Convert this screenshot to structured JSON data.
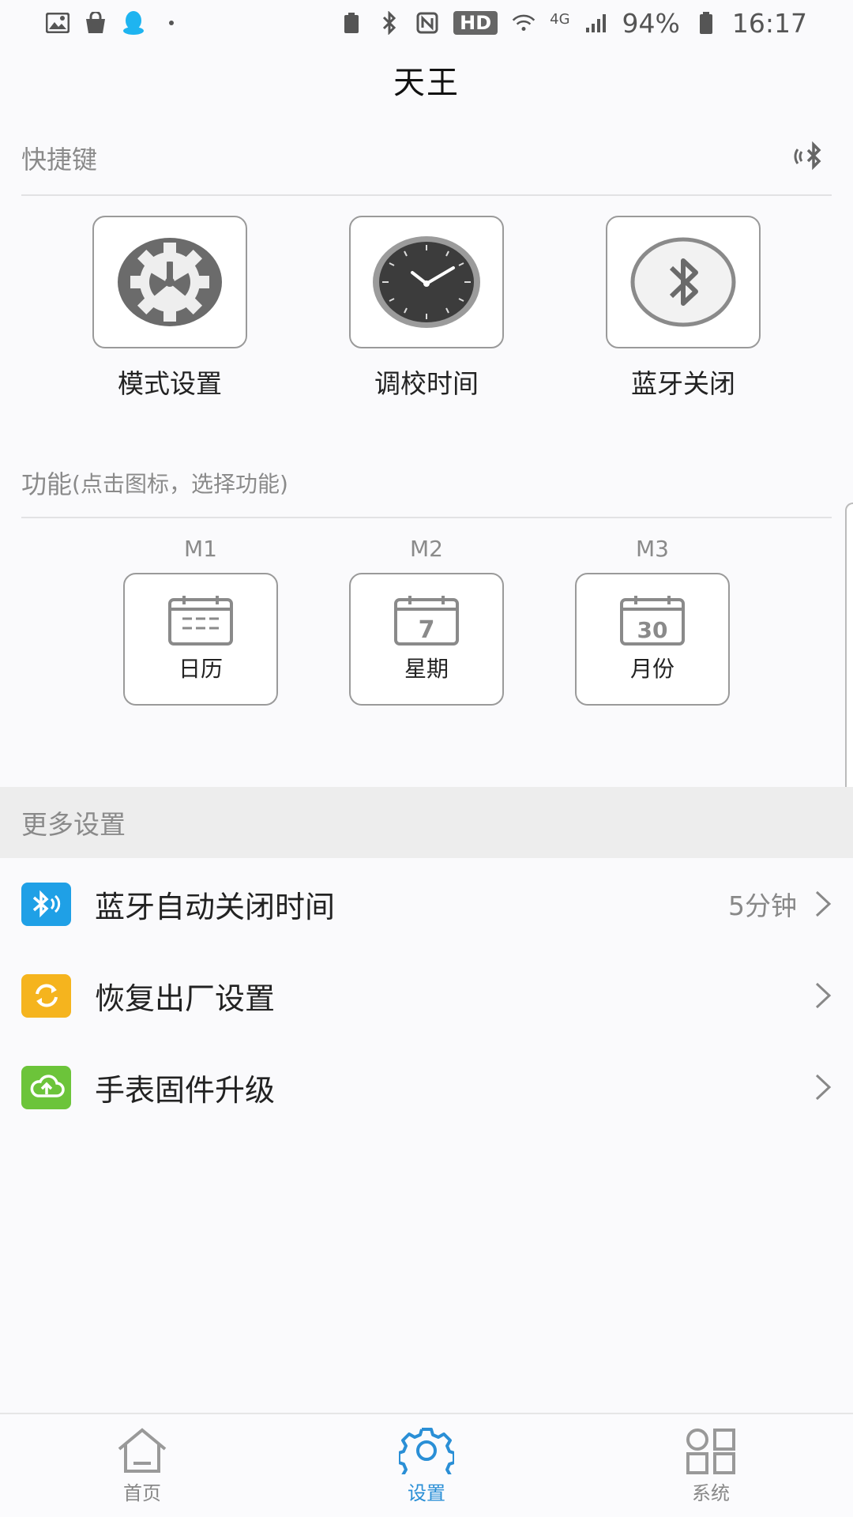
{
  "status_bar": {
    "hd_badge": "HD",
    "network": "4G",
    "battery": "94%",
    "time": "16:17"
  },
  "title": "天王",
  "shortcuts": {
    "header": "快捷键",
    "items": [
      {
        "label": "模式设置",
        "icon": "gear-icon"
      },
      {
        "label": "调校时间",
        "icon": "clock-icon"
      },
      {
        "label": "蓝牙关闭",
        "icon": "bluetooth-icon"
      }
    ]
  },
  "functions": {
    "header": "功能",
    "hint": "(点击图标，选择功能)",
    "slots": [
      {
        "slot": "M1",
        "label": "日历",
        "icon": "calendar-icon",
        "calendar_text": ""
      },
      {
        "slot": "M2",
        "label": "星期",
        "icon": "calendar-week-icon",
        "calendar_text": "7"
      },
      {
        "slot": "M3",
        "label": "月份",
        "icon": "calendar-month-icon",
        "calendar_text": "30"
      }
    ]
  },
  "more_settings": {
    "header": "更多设置",
    "items": [
      {
        "label": "蓝牙自动关闭时间",
        "value": "5分钟",
        "icon": "bluetooth-timer-icon",
        "color": "#1fa0e6"
      },
      {
        "label": "恢复出厂设置",
        "value": "",
        "icon": "refresh-icon",
        "color": "#f5b41e"
      },
      {
        "label": "手表固件升级",
        "value": "",
        "icon": "cloud-upload-icon",
        "color": "#6cc43a"
      }
    ]
  },
  "bottom_nav": {
    "items": [
      {
        "label": "首页",
        "icon": "home-icon",
        "active": false
      },
      {
        "label": "设置",
        "icon": "settings-icon",
        "active": true
      },
      {
        "label": "系统",
        "icon": "grid-icon",
        "active": false
      }
    ],
    "active_color": "#2a8fd6"
  }
}
